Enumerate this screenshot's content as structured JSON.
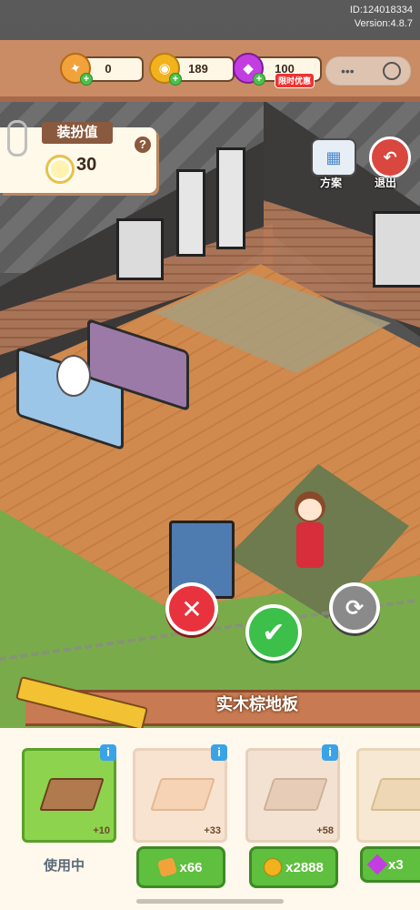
{
  "version": {
    "id": "ID:124018334",
    "version": "Version:4.8.7"
  },
  "resources": [
    {
      "icon": "ticket-icon",
      "value": "0",
      "color": "#f2a23a"
    },
    {
      "icon": "coin-icon",
      "value": "189",
      "color": "#f2b21e"
    },
    {
      "icon": "gem-icon",
      "value": "100",
      "color": "#c23ee0",
      "badge": "限时优惠"
    }
  ],
  "decoration": {
    "title": "装扮值",
    "value": "30"
  },
  "buttons": {
    "plan": "方案",
    "exit": "退出"
  },
  "item_name": "实木棕地板",
  "items": [
    {
      "bonus": "+10",
      "status": "使用中",
      "color": "#b07a4e"
    },
    {
      "bonus": "+33",
      "price": "x66",
      "currency": "ticket-icon",
      "color": "#f6d3b4"
    },
    {
      "bonus": "+58",
      "price": "x2888",
      "currency": "coin-icon",
      "color": "#e7cdb8"
    },
    {
      "price": "x3",
      "currency": "gem-icon",
      "color": "#edd7b5"
    }
  ]
}
